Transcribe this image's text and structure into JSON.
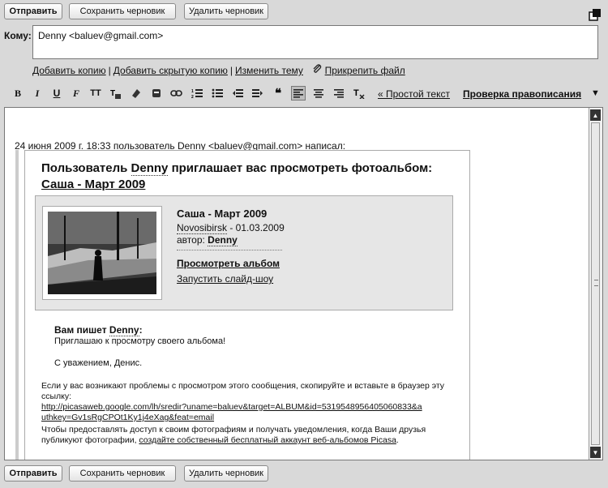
{
  "toolbar_top": {
    "send": "Отправить",
    "save_draft": "Сохранить черновик",
    "delete_draft": "Удалить черновик"
  },
  "to": {
    "label": "Кому:",
    "value": "Denny <baluev@gmail.com>"
  },
  "links": {
    "add_cc": "Добавить копию",
    "add_bcc": "Добавить скрытую копию",
    "edit_subject": "Изменить тему",
    "attach": "Прикрепить файл",
    "separator": "|"
  },
  "format": {
    "plain_text": "« Простой текст",
    "spellcheck": "Проверка правописания",
    "spellcheck_arrow": "▼"
  },
  "quote": {
    "prefix": "24 июня 2009",
    "year_abbr": "г.",
    "time_user": "18:33 пользователь",
    "user": "Denny",
    "suffix": "<baluev@gmail.com> написал:"
  },
  "invite": {
    "title_prefix": "Пользователь",
    "title_user": "Denny",
    "title_suffix": "приглашает вас просмотреть фотоальбом:",
    "album_link": "Саша - Март 2009"
  },
  "album": {
    "name": "Саша - Март 2009",
    "place": "Novosibirsk",
    "date": " - 01.03.2009",
    "author_label": "автор: ",
    "author": "Denny",
    "view": "Просмотреть альбом",
    "slideshow": "Запустить слайд-шоу"
  },
  "note": {
    "writes_label": "Вам пишет ",
    "writes_user": "Denny",
    "writes_colon": ":",
    "message": "Приглашаю к просмотру своего альбома!",
    "regards": "С уважением, Денис."
  },
  "footer": {
    "problem": "Если у вас возникают проблемы с просмотром этого сообщения, скопируйте и вставьте в браузер эту ссылку:",
    "link": "http://picasaweb.google.com/lh/sredir?uname=baluev&target=ALBUM&id=5319548956405060833&authkey=Gv1sRgCPOt1Ky1j4eXag&feat=email",
    "share_prefix": "Чтобы предоставлять доступ к своим фотографиям и получать уведомления, когда Ваши друзья публикуют фотографии, ",
    "share_link": "создайте собственный бесплатный аккаунт веб-альбомов Picasa",
    "share_suffix": "."
  },
  "toolbar_bottom": {
    "send": "Отправить",
    "save_draft": "Сохранить черновик",
    "delete_draft": "Удалить черновик"
  },
  "icons": [
    "bold-icon",
    "italic-icon",
    "underline-icon",
    "font-icon",
    "font-size-icon",
    "text-color-icon",
    "highlight-icon",
    "emoji-icon",
    "link-icon",
    "numbered-list-icon",
    "bulleted-list-icon",
    "outdent-icon",
    "indent-icon",
    "quote-icon",
    "align-left-icon",
    "align-center-icon",
    "align-right-icon",
    "remove-formatting-icon",
    "popout-icon",
    "paperclip-icon"
  ]
}
